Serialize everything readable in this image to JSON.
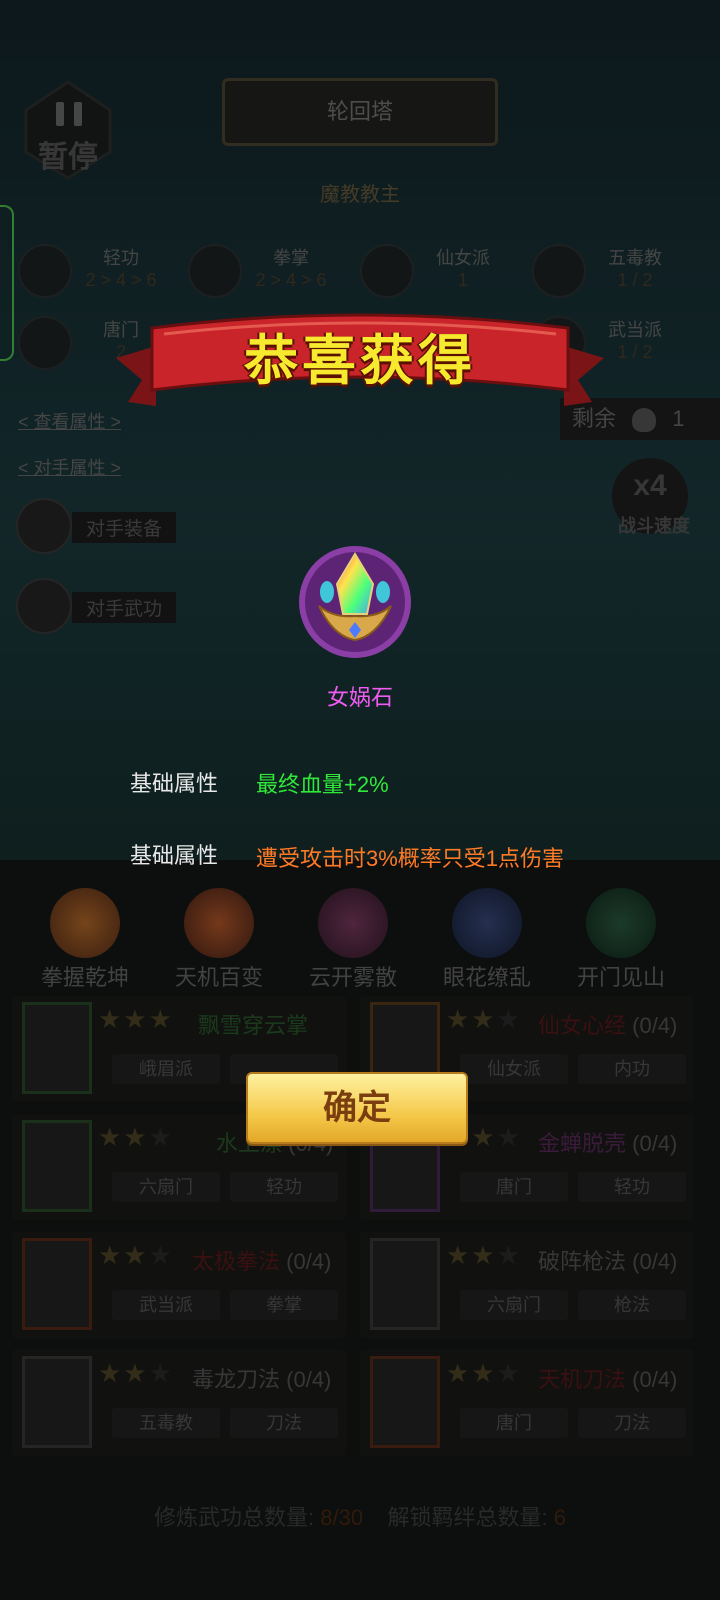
{
  "header": {
    "pause_icon_label": "暂停",
    "tower_title": "轮回塔",
    "boss_name": "魔教教主"
  },
  "traits": [
    {
      "name": "轻功",
      "value": "2 > 4 > 6"
    },
    {
      "name": "拳掌",
      "value": "2 > 4 > 6"
    },
    {
      "name": "仙女派",
      "value": "1"
    },
    {
      "name": "五毒教",
      "value": "1 / 2"
    },
    {
      "name": "唐门",
      "value": "2"
    },
    {
      "name": "武当派",
      "value": "1 / 2"
    }
  ],
  "side": {
    "view_attr": "< 查看属性 >",
    "opponent_attr": "< 对手属性 >",
    "opponent_equip": "对手装备",
    "opponent_skill": "对手武功",
    "remaining_label": "剩余",
    "remaining_count": "1",
    "speed_value": "x4",
    "speed_label": "战斗速度"
  },
  "skills": [
    "拳握乾坤",
    "天机百变",
    "云开雾散",
    "眼花缭乱",
    "开门见山"
  ],
  "cards": [
    {
      "name": "飘雪穿云掌",
      "progress": "",
      "tags": [
        "峨眉派",
        ""
      ],
      "stars": 3
    },
    {
      "name": "仙女心经",
      "progress": "(0/4)",
      "tags": [
        "仙女派",
        "内功"
      ],
      "stars": 2
    },
    {
      "name": "水上漂",
      "progress": "(0/4)",
      "tags": [
        "六扇门",
        "轻功"
      ],
      "stars": 2
    },
    {
      "name": "金蝉脱壳",
      "progress": "(0/4)",
      "tags": [
        "唐门",
        "轻功"
      ],
      "stars": 2
    },
    {
      "name": "太极拳法",
      "progress": "(0/4)",
      "tags": [
        "武当派",
        "拳掌"
      ],
      "stars": 2
    },
    {
      "name": "破阵枪法",
      "progress": "(0/4)",
      "tags": [
        "六扇门",
        "枪法"
      ],
      "stars": 2
    },
    {
      "name": "毒龙刀法",
      "progress": "(0/4)",
      "tags": [
        "五毒教",
        "刀法"
      ],
      "stars": 2
    },
    {
      "name": "天机刀法",
      "progress": "(0/4)",
      "tags": [
        "唐门",
        "刀法"
      ],
      "stars": 2
    }
  ],
  "footer": {
    "trained_label": "修炼武功总数量:",
    "trained_value": "8/30",
    "bond_label": "解锁羁绊总数量:",
    "bond_value": "6"
  },
  "popup": {
    "title": "恭喜获得",
    "item_name": "女娲石",
    "attrs": [
      {
        "label": "基础属性",
        "value": "最终血量+2%"
      },
      {
        "label": "基础属性",
        "value": "遭受攻击时3%概率只受1点伤害"
      }
    ],
    "confirm_label": "确定"
  },
  "colors": {
    "title_yellow": "#f7ea2e",
    "ribbon_red": "#c8242a",
    "item_purple": "#ef5cf2",
    "attr_green": "#30e83a",
    "attr_orange": "#ff7a26",
    "button_gold": "#f4c94a"
  },
  "icons": {
    "pause": "pause-icon",
    "item": "nuwa-stone-gem-icon",
    "remaining": "skull-icon"
  }
}
